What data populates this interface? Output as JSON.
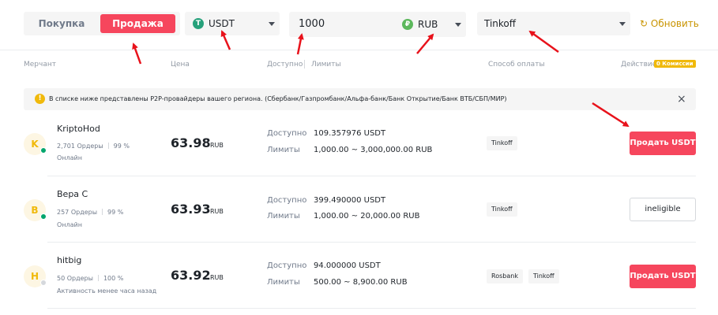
{
  "filters": {
    "tab_buy": "Покупка",
    "tab_sell": "Продажа",
    "asset": "USDT",
    "asset_icon_glyph": "T",
    "amount": "1000",
    "fiat": "RUB",
    "fiat_icon_glyph": "₽",
    "payment": "Tinkoff",
    "refresh": "Обновить"
  },
  "columns": {
    "merchant": "Мерчант",
    "price": "Цена",
    "available": "Доступно",
    "limits": "Лимиты",
    "payment": "Способ оплаты",
    "action": "Действие",
    "commission_badge": "0 Комиссии"
  },
  "notice": {
    "text": "В списке ниже представлены P2P-провайдеры вашего региона. (Сбербанк/Газпромбанк/Альфа-банк/Банк Открытие/Банк ВТБ/СБП/МИР)",
    "icon_glyph": "!",
    "close_glyph": "×"
  },
  "row_labels": {
    "available": "Доступно",
    "limits": "Лимиты"
  },
  "rows": [
    {
      "initial": "K",
      "name": "KriptoHod",
      "orders": "2,701 Ордеры",
      "completion": "99 %",
      "status": "Онлайн",
      "online": true,
      "price": "63.98",
      "currency": "RUB",
      "available": "109.357976 USDT",
      "limits": "1,000.00 ~ 3,000,000.00 RUB",
      "payments": [
        "Tinkoff"
      ],
      "action": "Продать USDT",
      "eligible": true
    },
    {
      "initial": "B",
      "name": "Вера С",
      "orders": "257 Ордеры",
      "completion": "99 %",
      "status": "Онлайн",
      "online": true,
      "price": "63.93",
      "currency": "RUB",
      "available": "399.490000 USDT",
      "limits": "1,000.00 ~ 20,000.00 RUB",
      "payments": [
        "Tinkoff"
      ],
      "action": "ineligible",
      "eligible": false
    },
    {
      "initial": "H",
      "name": "hitbig",
      "orders": "50 Ордеры",
      "completion": "100 %",
      "status": "Активность менее часа назад",
      "online": false,
      "price": "63.92",
      "currency": "RUB",
      "available": "94.000000 USDT",
      "limits": "500.00 ~ 8,900.00 RUB",
      "payments": [
        "Rosbank",
        "Tinkoff"
      ],
      "action": "Продать USDT",
      "eligible": true
    }
  ],
  "colors": {
    "sell_red": "#f6465d",
    "accent_yellow": "#f0b90b",
    "online_green": "#03a66d",
    "offline_grey": "#d5d8dc",
    "annotation_red": "#e8121b"
  }
}
